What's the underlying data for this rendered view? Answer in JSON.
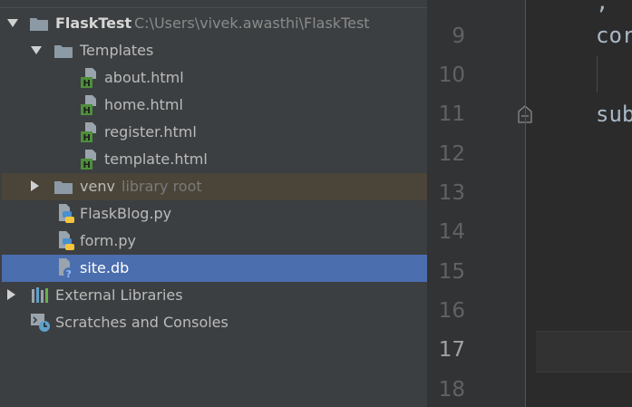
{
  "project_tree": {
    "root": {
      "name": "FlaskTest",
      "path": "C:\\Users\\vivek.awasthi\\FlaskTest"
    },
    "templates_folder": "Templates",
    "template_files": [
      "about.html",
      "home.html",
      "register.html",
      "template.html"
    ],
    "venv": {
      "name": "venv",
      "hint": "library root"
    },
    "py_files": [
      "FlaskBlog.py",
      "form.py"
    ],
    "db_file": "site.db",
    "external_libraries": "External Libraries",
    "scratches": "Scratches and Consoles"
  },
  "editor": {
    "line_numbers": [
      "9",
      "10",
      "11",
      "12",
      "13",
      "14",
      "15",
      "16",
      "17",
      "18"
    ],
    "current_line": "17",
    "code_fragments": [
      "cor",
      "sub"
    ]
  },
  "colors": {
    "tree_bg": "#3c3f41",
    "selection": "#4b6eaf",
    "venv_highlight": "#4a4538",
    "editor_bg": "#2b2b2b",
    "gutter_bg": "#313335",
    "html_icon": "#4e8f3a",
    "python_blue": "#4a8fd0",
    "python_yellow": "#f2c53d"
  }
}
